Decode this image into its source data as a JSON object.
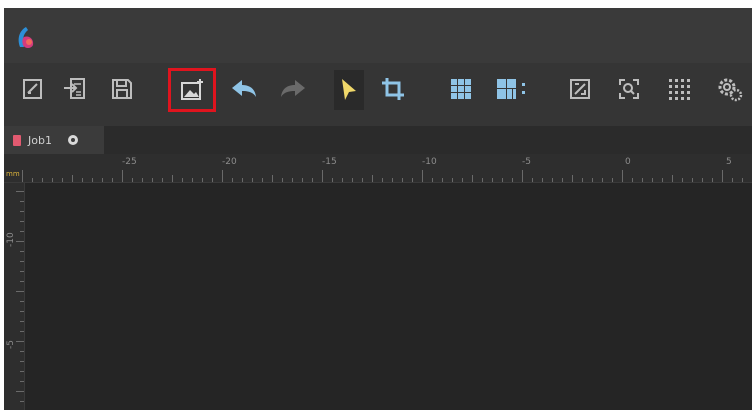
{
  "window": {
    "accent": "#e0141e",
    "logo_icon": "app-logo-icon"
  },
  "toolbar": {
    "buttons": [
      {
        "name": "edit-document-icon"
      },
      {
        "name": "import-file-icon"
      },
      {
        "name": "save-icon"
      },
      {
        "name": "add-image-icon",
        "highlighted": true
      },
      {
        "name": "undo-icon"
      },
      {
        "name": "redo-icon"
      },
      {
        "name": "select-pointer-icon"
      },
      {
        "name": "crop-icon"
      },
      {
        "name": "grid-array-icon"
      },
      {
        "name": "grid-layout-icon"
      },
      {
        "name": "fit-frame-icon"
      },
      {
        "name": "zoom-fit-icon"
      },
      {
        "name": "dot-grid-icon"
      },
      {
        "name": "settings-gear-icon"
      }
    ]
  },
  "tabs": [
    {
      "label": "Job1"
    }
  ],
  "ruler": {
    "unit": "mm",
    "h_labels": [
      "-25",
      "-20",
      "-15",
      "-10",
      "-5",
      "0",
      "5"
    ],
    "v_labels": [
      "-10",
      "-5"
    ]
  }
}
